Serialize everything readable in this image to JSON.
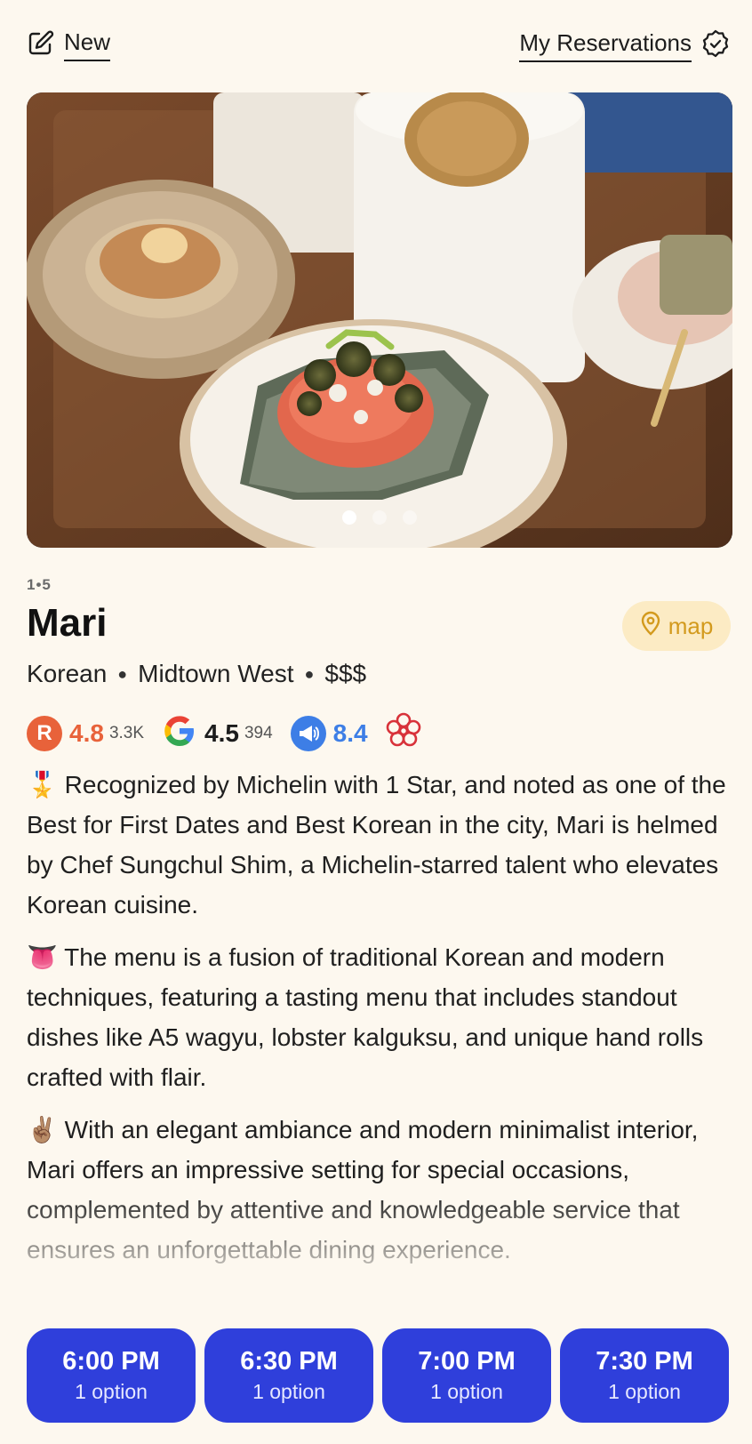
{
  "header": {
    "new_label": "New",
    "reservations_label": "My Reservations"
  },
  "hero": {
    "image_count": 3,
    "active_index": 0
  },
  "restaurant": {
    "rank_text": "1•5",
    "name": "Mari",
    "map_label": "map",
    "cuisine": "Korean",
    "neighborhood": "Midtown West",
    "price": "$$$",
    "ratings": {
      "resy_score": "4.8",
      "resy_count": "3.3K",
      "google_score": "4.5",
      "google_count": "394",
      "infatuation_score": "8.4"
    },
    "description": [
      {
        "emoji": "🎖️",
        "text": "Recognized by Michelin with 1 Star, and noted as one of the Best for First Dates and Best Korean in the city, Mari is helmed by Chef Sungchul Shim, a Michelin-starred talent who elevates Korean cuisine."
      },
      {
        "emoji": "👅",
        "text": "The menu is a fusion of traditional Korean and modern techniques, featuring a tasting menu that includes standout dishes like A5 wagyu, lobster kalguksu, and unique hand rolls crafted with flair."
      },
      {
        "emoji": "✌🏽",
        "text": "With an elegant ambiance and modern minimalist interior, Mari offers an impressive setting for special occasions, complemented by attentive and knowledgeable service that ensures an unforgettable dining experience."
      }
    ]
  },
  "time_slots": [
    {
      "time": "6:00 PM",
      "options": "1 option"
    },
    {
      "time": "6:30 PM",
      "options": "1 option"
    },
    {
      "time": "7:00 PM",
      "options": "1 option"
    },
    {
      "time": "7:30 PM",
      "options": "1 option"
    }
  ],
  "colors": {
    "background": "#fdf8ef",
    "slot_blue": "#2f3fdb",
    "map_bg": "#fcebc4",
    "map_text": "#d39a1d",
    "resy_red": "#e8623a",
    "infatuation_blue": "#3d7ee6",
    "michelin_red": "#d8323a"
  },
  "icons": [
    "edit-icon",
    "verified-badge-icon",
    "map-pin-icon",
    "resy-r-icon",
    "google-g-icon",
    "megaphone-icon",
    "michelin-flower-icon"
  ]
}
